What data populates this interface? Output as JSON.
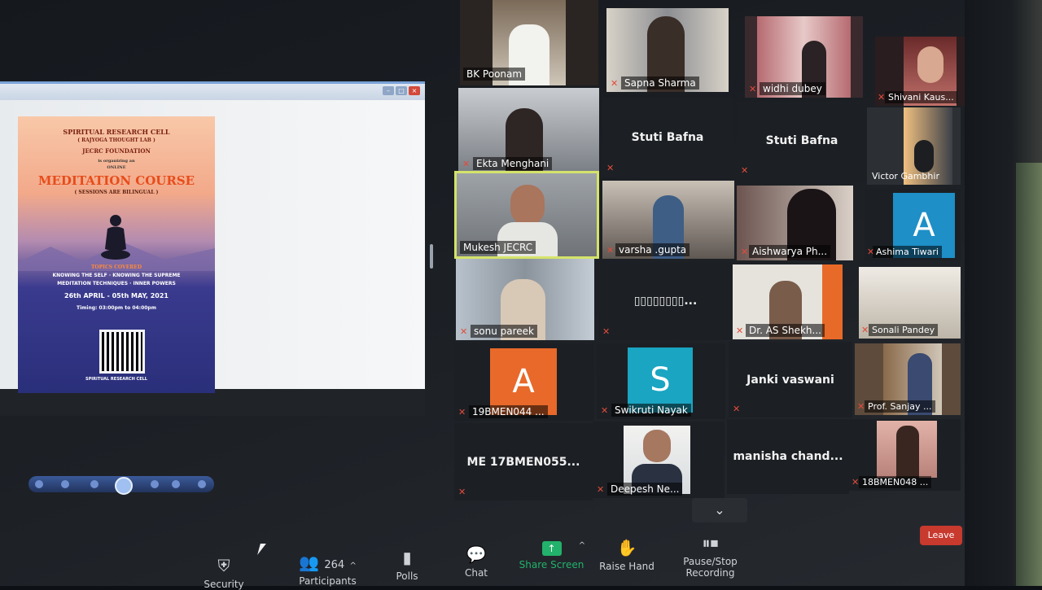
{
  "shared_document": {
    "poster": {
      "org": "SPIRITUAL RESEARCH CELL",
      "lab": "( RAJYOGA THOUGHT LAB )",
      "foundation": "JECRC FOUNDATION",
      "organizing": "is organizing an",
      "online": "ONLINE",
      "course_title": "MEDITATION COURSE",
      "bilingual": "( SESSIONS ARE BILINGUAL )",
      "topics_heading": "TOPICS COVERED",
      "topics_line1": "KNOWING THE SELF · KNOWING THE SUPREME",
      "topics_line2": "MEDITATION TECHNIQUES · INNER POWERS",
      "dates": "26th APRIL - 05th MAY, 2021",
      "timing": "Timing: 03:00pm to 04:00pm",
      "footer_cell": "SPIRITUAL RESEARCH CELL"
    }
  },
  "participants": [
    {
      "name": "BK Poonam",
      "muted": false
    },
    {
      "name": "Sapna Sharma",
      "muted": true
    },
    {
      "name": "widhi dubey",
      "muted": true
    },
    {
      "name": "Shivani Kaus...",
      "muted": true
    },
    {
      "name": "Ekta Menghani",
      "muted": true
    },
    {
      "name": "Stuti Bafna",
      "muted": true
    },
    {
      "name": "Stuti Bafna",
      "muted": true
    },
    {
      "name": "Victor Gambhir",
      "muted": false
    },
    {
      "name": "Mukesh JECRC",
      "muted": false
    },
    {
      "name": "varsha .gupta",
      "muted": true
    },
    {
      "name": "Aishwarya Ph...",
      "muted": true
    },
    {
      "name": "Ashima Tiwari",
      "muted": true,
      "avatar": "A"
    },
    {
      "name": "sonu pareek",
      "muted": true
    },
    {
      "name": "▯▯▯▯▯▯▯▯...",
      "muted": true
    },
    {
      "name": "Dr. AS Shekh...",
      "muted": true
    },
    {
      "name": "Sonali Pandey",
      "muted": true
    },
    {
      "name": "19BMEN044 ...",
      "muted": true,
      "avatar": "A"
    },
    {
      "name": "Swikruti Nayak",
      "muted": true,
      "avatar": "S"
    },
    {
      "name": "Janki vaswani",
      "muted": true
    },
    {
      "name": "Prof. Sanjay ...",
      "muted": true
    },
    {
      "name": "ME 17BMEN055...",
      "muted": true
    },
    {
      "name": "Deepesh Ne...",
      "muted": true
    },
    {
      "name": "manisha  chand...",
      "muted": false
    },
    {
      "name": "18BMEN048 ...",
      "muted": true
    }
  ],
  "toolbar": {
    "security": "Security",
    "participants": "Participants",
    "participant_count": "264",
    "polls": "Polls",
    "chat": "Chat",
    "share_screen": "Share Screen",
    "raise_hand": "Raise Hand",
    "record": "Pause/Stop Recording",
    "leave": "Leave"
  },
  "colors": {
    "active_speaker": "#d4e36a",
    "share_green": "#23b26b",
    "leave_red": "#c8392e",
    "avatar_blue": "#1e8fc7",
    "avatar_orange": "#e8692a",
    "avatar_teal": "#1aa5c2"
  }
}
